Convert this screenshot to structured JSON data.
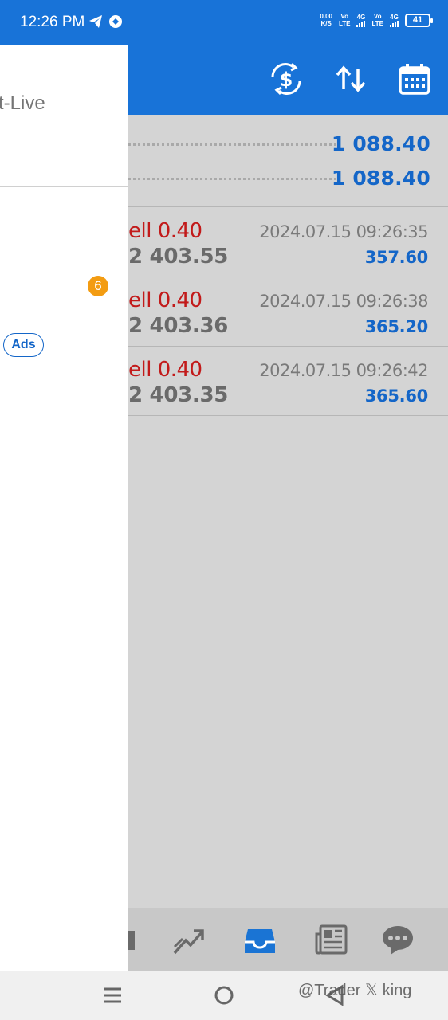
{
  "status_bar": {
    "time": "12:26 PM",
    "net_speed_value": "0.00",
    "net_speed_unit": "K/S",
    "volte_label_line1": "Vo",
    "volte_label_line2": "LTE",
    "network_4g": "4G",
    "battery": "41"
  },
  "drawer": {
    "account_label": "t-Live",
    "badge_count": "6",
    "ads_label": "Ads"
  },
  "summary": [
    {
      "value": "1 088.40"
    },
    {
      "value": "1 088.40"
    }
  ],
  "deals": [
    {
      "type": "ell 0.40",
      "price": "2 403.55",
      "time": "2024.07.15 09:26:35",
      "profit": "357.60"
    },
    {
      "type": "ell 0.40",
      "price": "2 403.36",
      "time": "2024.07.15 09:26:38",
      "profit": "365.20"
    },
    {
      "type": "ell 0.40",
      "price": "2 403.35",
      "time": "2024.07.15 09:26:42",
      "profit": "365.60"
    }
  ],
  "header_icons": [
    "currency-exchange-icon",
    "sort-icon",
    "calendar-icon"
  ],
  "bottom_nav": [
    "quotes-icon",
    "trade-chart-icon",
    "history-inbox-icon",
    "news-icon",
    "chat-icon"
  ],
  "watermark": "@Trader 𝕏 king",
  "colors": {
    "primary": "#1873d8",
    "sell": "#c21a1a",
    "profit": "#1466c8",
    "badge": "#f39c12",
    "background": "#d4d4d4"
  }
}
